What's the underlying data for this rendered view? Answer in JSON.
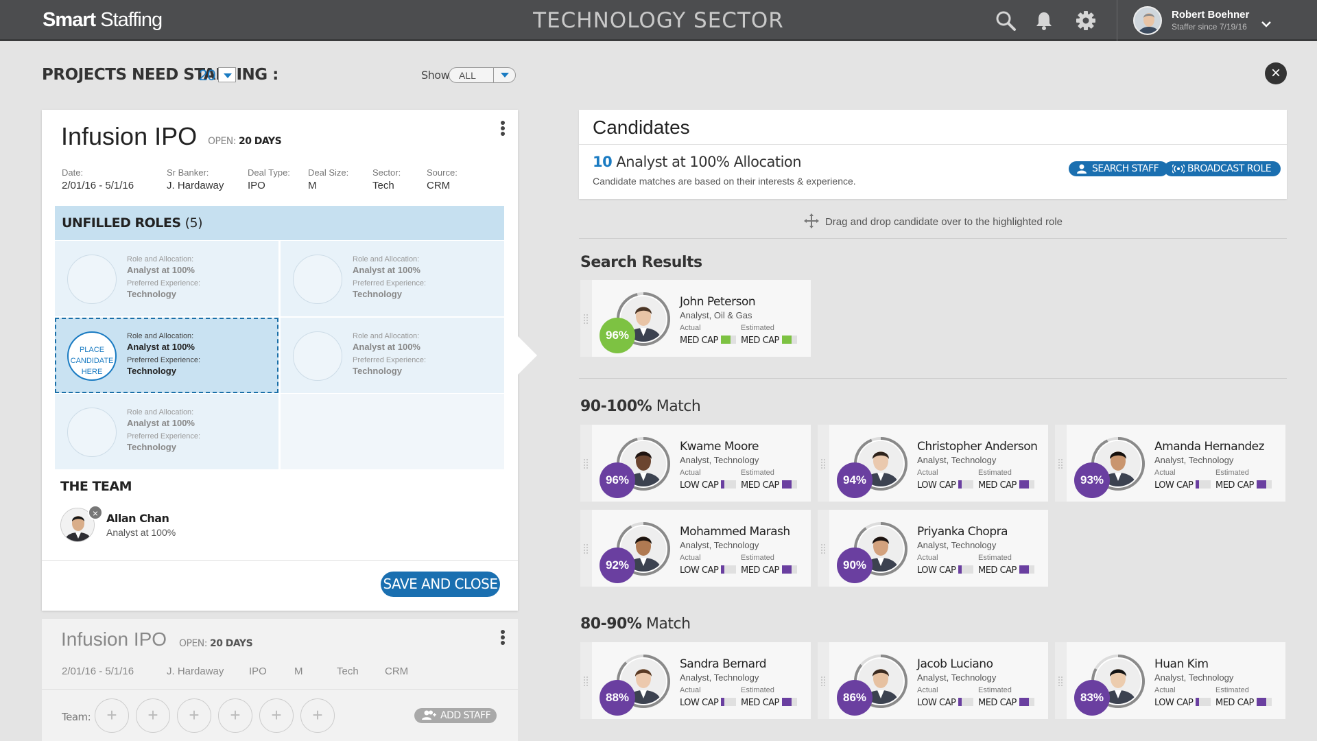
{
  "app": {
    "logo_bold": "Smart",
    "logo_light": "Staffing",
    "sector": "TECHNOLOGY  SECTOR"
  },
  "user": {
    "name": "Robert Boehner",
    "subtitle": "Staffer since 7/19/16"
  },
  "header": {
    "projects_label": "PROJECTS NEED STAFFING :",
    "projects_count": "20",
    "show_label": "Show",
    "show_value": "ALL"
  },
  "project": {
    "title": "Infusion IPO",
    "open_label": "OPEN:",
    "open_value": "20 DAYS",
    "meta": [
      {
        "k": "Date:",
        "v": "2/01/16 - 5/1/16"
      },
      {
        "k": "Sr Banker:",
        "v": "J. Hardaway"
      },
      {
        "k": "Deal Type:",
        "v": "IPO"
      },
      {
        "k": "Deal Size:",
        "v": "M"
      },
      {
        "k": "Sector:",
        "v": "Tech"
      },
      {
        "k": "Source:",
        "v": "CRM"
      }
    ],
    "roles_head": "UNFILLED ROLES",
    "roles_count": "(5)",
    "role_k1": "Role and Allocation:",
    "role_v1": "Analyst at 100%",
    "role_k2": "Preferred Experience:",
    "role_v2": "Technology",
    "place_here": "PLACE CANDIDATE HERE",
    "team_head": "THE TEAM",
    "team_member": {
      "name": "Allan Chan",
      "role": "Analyst at 100%"
    },
    "save_label": "SAVE AND CLOSE"
  },
  "project2": {
    "title": "Infusion IPO",
    "open_label": "OPEN:",
    "open_value": "20 DAYS",
    "meta": [
      "2/01/16 - 5/1/16",
      "J. Hardaway",
      "IPO",
      "M",
      "Tech",
      "CRM"
    ],
    "team_label": "Team:",
    "add_staff": "ADD STAFF"
  },
  "candidates": {
    "title": "Candidates",
    "count": "10",
    "count_label": "Analyst at 100% Allocation",
    "sub": "Candidate matches are based on their interests & experience.",
    "search_staff": "SEARCH STAFF",
    "broadcast_role": "BROADCAST ROLE",
    "drag_hint": "Drag and drop candidate over to the highlighted role",
    "search_results": "Search Results",
    "sec1_bold": "90-100%",
    "sec1_rest": " Match",
    "sec2_bold": "80-90%",
    "sec2_rest": " Match",
    "actual_label": "Actual",
    "estimated_label": "Estimated"
  },
  "colors": {
    "green": "#7dc242",
    "purple": "#6a3fa0",
    "blue": "#1a6fb0"
  },
  "cards": [
    {
      "name": "John Peterson",
      "role": "Analyst, Oil & Gas",
      "pct": "96%",
      "pct_value": 96,
      "actual": "MED CAP",
      "estimated": "MED CAP",
      "actual_fill": 0.66,
      "estimated_fill": 0.66,
      "color": "#7dc242",
      "skin": "#e8c4a6",
      "hair": "#4a3526"
    },
    {
      "name": "Kwame Moore",
      "role": "Analyst, Technology",
      "pct": "96%",
      "pct_value": 96,
      "actual": "LOW CAP",
      "estimated": "MED CAP",
      "actual_fill": 0.2,
      "estimated_fill": 0.66,
      "color": "#6a3fa0",
      "skin": "#6b4530",
      "hair": "#1f1410"
    },
    {
      "name": "Christopher Anderson",
      "role": "Analyst, Technology",
      "pct": "94%",
      "pct_value": 94,
      "actual": "LOW CAP",
      "estimated": "MED CAP",
      "actual_fill": 0.2,
      "estimated_fill": 0.66,
      "color": "#6a3fa0",
      "skin": "#eac9ae",
      "hair": "#2d221b"
    },
    {
      "name": "Amanda Hernandez",
      "role": "Analyst, Technology",
      "pct": "93%",
      "pct_value": 93,
      "actual": "LOW CAP",
      "estimated": "MED CAP",
      "actual_fill": 0.2,
      "estimated_fill": 0.66,
      "color": "#6a3fa0",
      "skin": "#c9956e",
      "hair": "#15100d"
    },
    {
      "name": "Mohammed Marash",
      "role": "Analyst, Technology",
      "pct": "92%",
      "pct_value": 92,
      "actual": "LOW CAP",
      "estimated": "MED CAP",
      "actual_fill": 0.2,
      "estimated_fill": 0.66,
      "color": "#6a3fa0",
      "skin": "#b07a52",
      "hair": "#1a120d"
    },
    {
      "name": "Priyanka Chopra",
      "role": "Analyst, Technology",
      "pct": "90%",
      "pct_value": 90,
      "actual": "LOW CAP",
      "estimated": "MED CAP",
      "actual_fill": 0.2,
      "estimated_fill": 0.66,
      "color": "#6a3fa0",
      "skin": "#d3a27e",
      "hair": "#1b1310"
    },
    {
      "name": "Sandra Bernard",
      "role": "Analyst, Technology",
      "pct": "88%",
      "pct_value": 88,
      "actual": "LOW CAP",
      "estimated": "MED CAP",
      "actual_fill": 0.2,
      "estimated_fill": 0.66,
      "color": "#6a3fa0",
      "skin": "#ecc9ad",
      "hair": "#5a3a24"
    },
    {
      "name": "Jacob Luciano",
      "role": "Analyst, Technology",
      "pct": "86%",
      "pct_value": 86,
      "actual": "LOW CAP",
      "estimated": "MED CAP",
      "actual_fill": 0.2,
      "estimated_fill": 0.66,
      "color": "#6a3fa0",
      "skin": "#e6c1a1",
      "hair": "#3a2a20"
    },
    {
      "name": "Huan Kim",
      "role": "Analyst, Technology",
      "pct": "83%",
      "pct_value": 83,
      "actual": "LOW CAP",
      "estimated": "MED CAP",
      "actual_fill": 0.2,
      "estimated_fill": 0.66,
      "color": "#6a3fa0",
      "skin": "#ecccae",
      "hair": "#141414"
    }
  ]
}
